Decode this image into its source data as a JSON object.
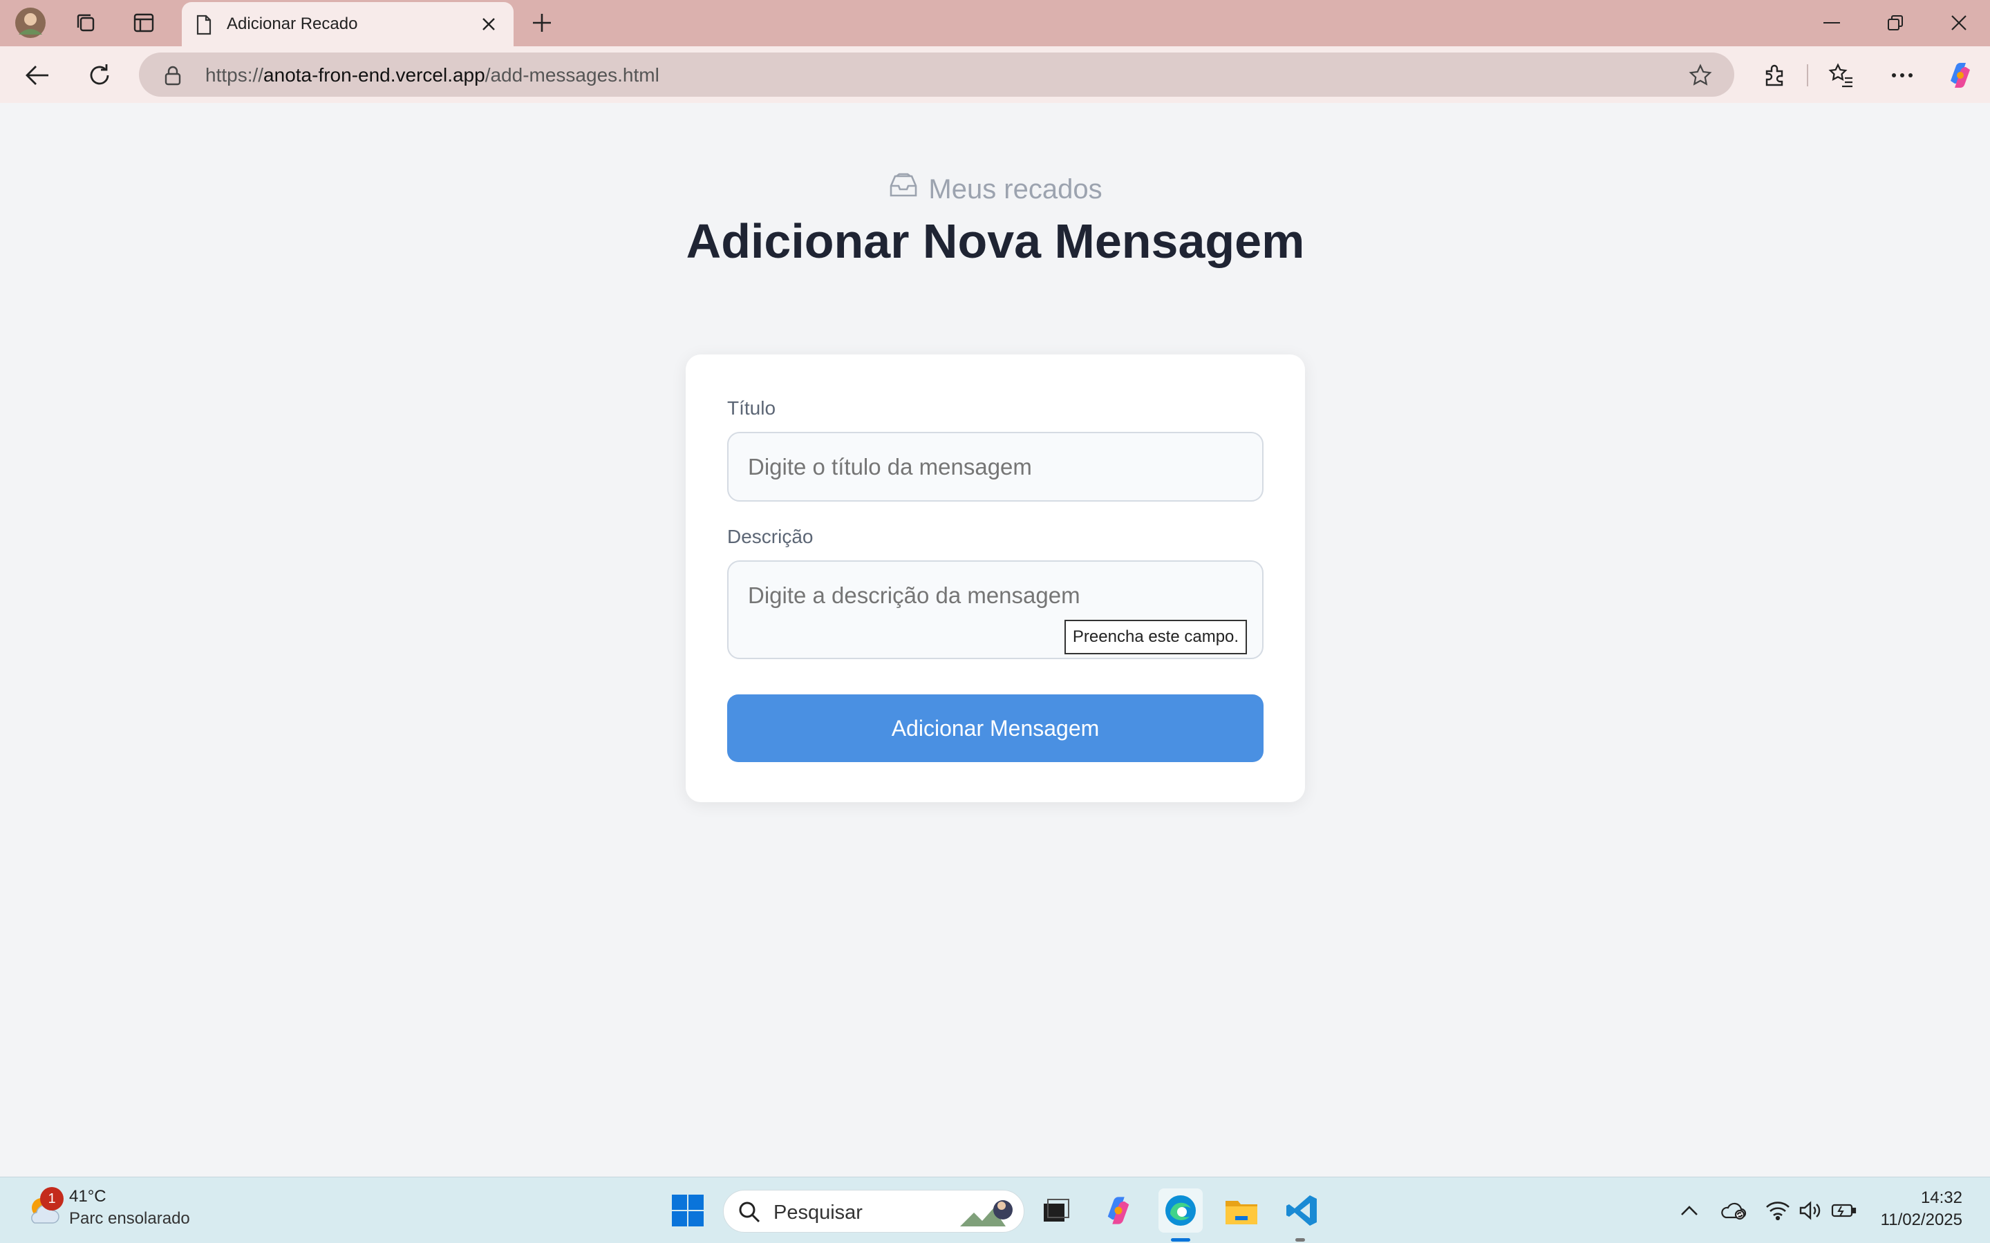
{
  "browser": {
    "tab_title": "Adicionar Recado",
    "url_prefix": "https://",
    "url_host": "anota-fron-end.vercel.app",
    "url_path": "/add-messages.html"
  },
  "page": {
    "brand": "Meus recados",
    "heading": "Adicionar Nova Mensagem",
    "form": {
      "title_label": "Título",
      "title_placeholder": "Digite o título da mensagem",
      "description_label": "Descrição",
      "description_placeholder": "Digite a descrição da mensagem",
      "submit_label": "Adicionar Mensagem",
      "validation_tooltip": "Preencha este campo."
    }
  },
  "taskbar": {
    "weather_temp": "41°C",
    "weather_desc": "Parc ensolarado",
    "weather_badge": "1",
    "search_label": "Pesquisar",
    "time": "14:32",
    "date": "11/02/2025"
  },
  "colors": {
    "titlebar": "#dbb1ae",
    "accent_button": "#4a90e2",
    "heading": "#1f2433"
  }
}
